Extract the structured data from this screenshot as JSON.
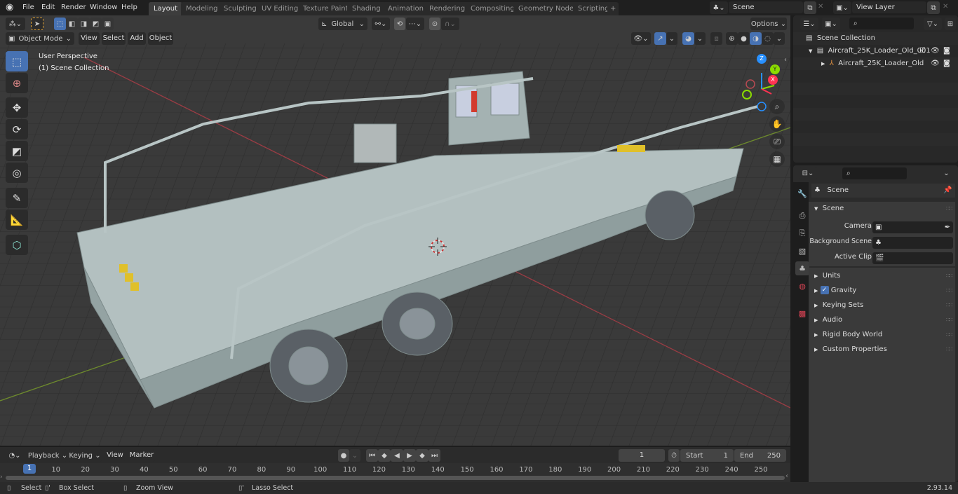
{
  "app": {
    "version": "2.93.14"
  },
  "menubar": {
    "items": [
      "File",
      "Edit",
      "Render",
      "Window",
      "Help"
    ]
  },
  "workspaces": {
    "tabs": [
      "Layout",
      "Modeling",
      "Sculpting",
      "UV Editing",
      "Texture Paint",
      "Shading",
      "Animation",
      "Rendering",
      "Compositing",
      "Geometry Nodes",
      "Scripting"
    ],
    "active": "Layout",
    "add_label": "+"
  },
  "scene_selector": {
    "value": "Scene"
  },
  "viewlayer_selector": {
    "value": "View Layer"
  },
  "viewport": {
    "mode": "Object Mode",
    "menus": [
      "View",
      "Select",
      "Add",
      "Object"
    ],
    "transform_orientation": "Global",
    "options_label": "Options",
    "overlay_title": "User Perspective",
    "overlay_subtitle": "(1) Scene Collection",
    "gizmo_axes": {
      "x": "X",
      "y": "Y",
      "z": "Z"
    },
    "axis_colors": {
      "x": "#ff3352",
      "y": "#8bdc00",
      "z": "#2890ff"
    }
  },
  "toolbar": {
    "tools": [
      "select-box",
      "cursor",
      "move",
      "rotate",
      "scale",
      "transform",
      "annotate",
      "measure",
      "add-cube"
    ],
    "active": "select-box"
  },
  "outliner": {
    "root": "Scene Collection",
    "items": [
      {
        "label": "Aircraft_25K_Loader_Old_001",
        "type": "collection",
        "checked": true
      },
      {
        "label": "Aircraft_25K_Loader_Old",
        "type": "empty"
      }
    ]
  },
  "properties": {
    "header_title": "Scene",
    "panel_title": "Scene",
    "fields": [
      {
        "label": "Camera",
        "value": ""
      },
      {
        "label": "Background Scene",
        "value": ""
      },
      {
        "label": "Active Clip",
        "value": ""
      }
    ],
    "sections": [
      {
        "label": "Units"
      },
      {
        "label": "Gravity",
        "checkbox": true
      },
      {
        "label": "Keying Sets"
      },
      {
        "label": "Audio"
      },
      {
        "label": "Rigid Body World"
      },
      {
        "label": "Custom Properties"
      }
    ]
  },
  "timeline": {
    "menus": [
      "Playback",
      "Keying",
      "View",
      "Marker"
    ],
    "current_frame": "1",
    "start_label": "Start",
    "start": "1",
    "end_label": "End",
    "end": "250",
    "ticks": [
      "10",
      "20",
      "30",
      "40",
      "50",
      "60",
      "70",
      "80",
      "90",
      "100",
      "110",
      "120",
      "130",
      "140",
      "150",
      "160",
      "170",
      "180",
      "190",
      "200",
      "210",
      "220",
      "230",
      "240",
      "250"
    ],
    "playhead": "1"
  },
  "statusbar": {
    "hints": [
      "Select",
      "Box Select",
      "Zoom View",
      "Lasso Select"
    ]
  }
}
